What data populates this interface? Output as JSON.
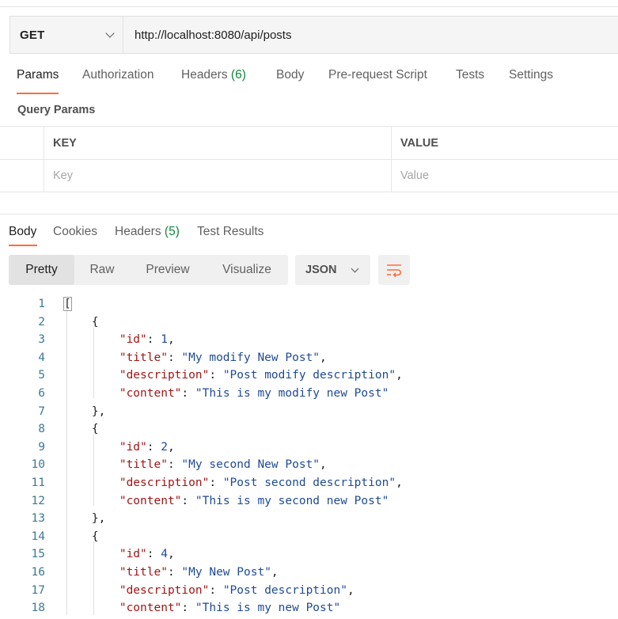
{
  "request": {
    "method": "GET",
    "url": "http://localhost:8080/api/posts"
  },
  "request_tabs": [
    {
      "label": "Params",
      "count": ""
    },
    {
      "label": "Authorization",
      "count": ""
    },
    {
      "label": "Headers",
      "count": "(6)"
    },
    {
      "label": "Body",
      "count": ""
    },
    {
      "label": "Pre-request Script",
      "count": ""
    },
    {
      "label": "Tests",
      "count": ""
    },
    {
      "label": "Settings",
      "count": ""
    }
  ],
  "query_params": {
    "title": "Query Params",
    "key_header": "KEY",
    "value_header": "VALUE",
    "key_placeholder": "Key",
    "value_placeholder": "Value"
  },
  "response_tabs": [
    {
      "label": "Body",
      "count": ""
    },
    {
      "label": "Cookies",
      "count": ""
    },
    {
      "label": "Headers",
      "count": "(5)"
    },
    {
      "label": "Test Results",
      "count": ""
    }
  ],
  "view_modes": [
    "Pretty",
    "Raw",
    "Preview",
    "Visualize"
  ],
  "format": "JSON",
  "colors": {
    "accent": "#ff6c37",
    "count_green": "#0f8a3a",
    "json_key": "#a31515",
    "json_value": "#1f4a95"
  },
  "posts": [
    {
      "id": "1",
      "title": "My modify New Post",
      "description": "Post modify description",
      "content": "This is my modify new Post"
    },
    {
      "id": "2",
      "title": "My second New Post",
      "description": "Post second description",
      "content": "This is my second new Post"
    },
    {
      "id": "4",
      "title": "My New Post",
      "description": "Post description",
      "content": "This is my new Post"
    }
  ]
}
